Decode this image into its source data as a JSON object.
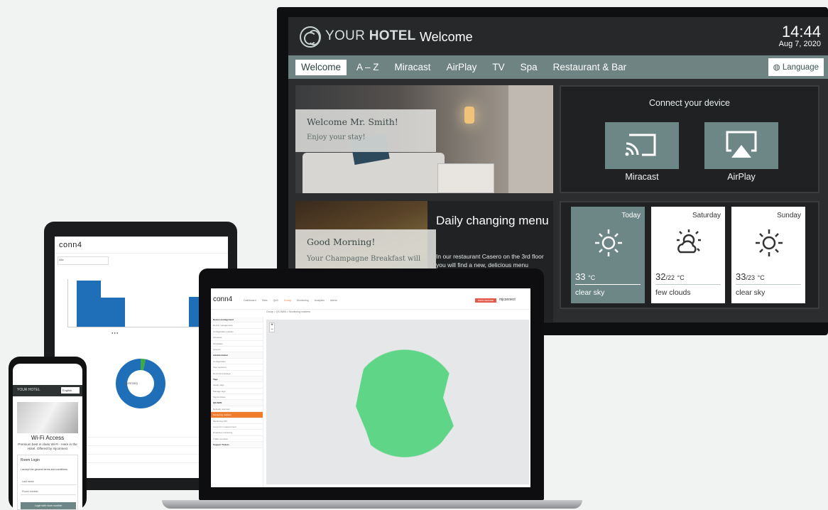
{
  "tv": {
    "logo": {
      "pre": "YOUR ",
      "bold": "HOTEL"
    },
    "title": "Welcome",
    "time": "14:44",
    "date": "Aug 7, 2020",
    "nav": [
      "Welcome",
      "A – Z",
      "Miracast",
      "AirPlay",
      "TV",
      "Spa",
      "Restaurant & Bar"
    ],
    "language": "Language",
    "welcome_card": {
      "heading": "Welcome Mr. Smith!",
      "sub": "Enjoy your stay!"
    },
    "connect": {
      "heading": "Connect your device",
      "miracast": "Miracast",
      "airplay": "AirPlay"
    },
    "morning_card": {
      "heading": "Good Morning!",
      "sub": "Your Champagne Breakfast will"
    },
    "daily": {
      "title": "Daily changing menu",
      "text": "In our restaurant Casero on the 3rd floor you will find a new, delicious menu"
    },
    "weather": [
      {
        "day": "Today",
        "temp": "33",
        "temp_low": "",
        "unit": "°C",
        "cond": "clear sky",
        "icon": "sun-icon"
      },
      {
        "day": "Saturday",
        "temp": "32",
        "temp_low": "/22",
        "unit": "°C",
        "cond": "few clouds",
        "icon": "sun-cloud-icon"
      },
      {
        "day": "Sunday",
        "temp": "33",
        "temp_low": "/23",
        "unit": "°C",
        "cond": "clear sky",
        "icon": "sun-icon"
      }
    ],
    "colors": {
      "accent": "#6c8786",
      "bg": "#2b2d2e"
    }
  },
  "tablet": {
    "logo": "conn4",
    "field": "Alle",
    "chart_data": {
      "type": "bar",
      "categories": [
        "",
        "",
        ""
      ],
      "series": [
        {
          "name": "",
          "values": [
            95,
            60,
            62
          ]
        }
      ],
      "bars": [
        0.95,
        0.6,
        0.62
      ]
    },
    "donut_label": "Summary"
  },
  "laptop": {
    "logo": "conn4",
    "menu": [
      "Dashboard",
      "Sites",
      "QoS",
      "Group",
      "Monitoring",
      "Analytics",
      "Admin"
    ],
    "badge": "PROD README",
    "brand": "mjconnect",
    "crumb": "Group > QS-WAN > Monitoring markers",
    "sidebar": [
      {
        "label": "Device management",
        "type": "sect"
      },
      {
        "label": "Device management"
      },
      {
        "label": "Configuration policies"
      },
      {
        "label": "Firmware"
      },
      {
        "label": "Templates"
      },
      {
        "label": "Queues"
      },
      {
        "label": "Administration",
        "type": "sect"
      },
      {
        "label": "Configuration"
      },
      {
        "label": "User sessions"
      },
      {
        "label": "Document storage"
      },
      {
        "label": "Tags",
        "type": "sect"
      },
      {
        "label": "Assign tags"
      },
      {
        "label": "Manage tags"
      },
      {
        "label": "Tag functions"
      },
      {
        "label": "QS-WAN",
        "type": "sect"
      },
      {
        "label": "Network overview"
      },
      {
        "label": "Monitoring markers",
        "type": "on"
      },
      {
        "label": "Monitoring KPI"
      },
      {
        "label": "Long term measurement"
      },
      {
        "label": "Proactive monitoring"
      },
      {
        "label": "Traffic overview"
      },
      {
        "label": "Support Tickets",
        "type": "sect"
      }
    ]
  },
  "phone": {
    "logo": "YOUR HOTEL",
    "lang": "English",
    "title": "Wi-Fi Access",
    "desc": "Premium best in class Wi-Fi - Here in the Hotel. Offered by mjconnect",
    "login_label": "Room Login",
    "accept": "I accept the general terms and conditions.",
    "lastname": "Last name",
    "room": "Room number",
    "button": "Login with room number"
  }
}
